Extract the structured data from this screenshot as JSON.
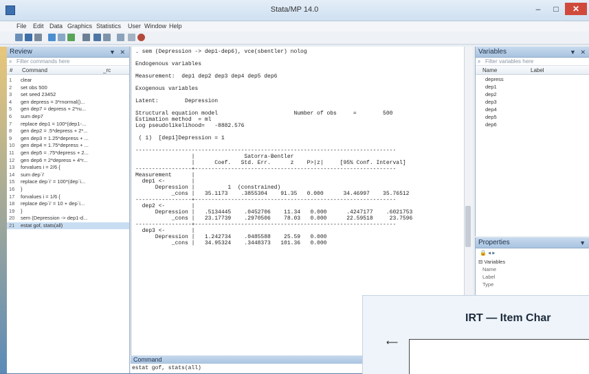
{
  "window": {
    "title": "Stata/MP 14.0",
    "min": "–",
    "max": "□",
    "close": "✕"
  },
  "menu": [
    "File",
    "Edit",
    "Data",
    "Graphics",
    "Statistics",
    "User",
    "Window",
    "Help"
  ],
  "review": {
    "title": "Review",
    "filter_placeholder": "Filter commands here",
    "col_num": "#",
    "col_cmd": "Command",
    "col_rc": "_rc",
    "items": [
      {
        "n": "1",
        "c": "clear"
      },
      {
        "n": "2",
        "c": "set obs 500"
      },
      {
        "n": "3",
        "c": "set seed 23452"
      },
      {
        "n": "4",
        "c": "gen depress = 3*rnormal()..."
      },
      {
        "n": "5",
        "c": "gen dep7 = depress + 2*ru..."
      },
      {
        "n": "6",
        "c": "sum dep7"
      },
      {
        "n": "7",
        "c": "replace dep1 = 100*(dep1-..."
      },
      {
        "n": "8",
        "c": "gen dep2 = .5*depress + 2*..."
      },
      {
        "n": "9",
        "c": "gen dep3 = 1.25*depress + ..."
      },
      {
        "n": "10",
        "c": "gen dep4 = 1.75*depress + ..."
      },
      {
        "n": "11",
        "c": "gen dep5 = .75*depress + 2..."
      },
      {
        "n": "12",
        "c": "gen dep6 = 2*depress + 4*r..."
      },
      {
        "n": "13",
        "c": "forvalues i = 2/6 {"
      },
      {
        "n": "14",
        "c": "  sum dep`i'"
      },
      {
        "n": "15",
        "c": "  replace dep`i' = 100*(dep`i..."
      },
      {
        "n": "16",
        "c": "}"
      },
      {
        "n": "17",
        "c": "forvalues i = 1/6 {"
      },
      {
        "n": "18",
        "c": "  replace dep`i' = 10 + dep`i..."
      },
      {
        "n": "19",
        "c": "}"
      },
      {
        "n": "20",
        "c": "sem (Depression -> dep1-d..."
      },
      {
        "n": "21",
        "c": "estat gof, stats(all)"
      }
    ]
  },
  "results": {
    "text": ". sem (Depression -> dep1-dep6), vce(sbentler) nolog\n\nEndogenous variables\n\nMeasurement:  dep1 dep2 dep3 dep4 dep5 dep6\n\nExogenous variables\n\nLatent:        Depression\n\nStructural equation model                       Number of obs     =        500\nEstimation method  = ml\nLog pseudolikelihood=   -8882.576\n\n ( 1)  [dep1]Depression = 1\n\n-------------------------------------------------------------------------------\n                 |               Satorra-Bentler\n                 |      Coef.   Std. Err.      z    P>|z|     [95% Conf. Interval]\n-----------------+-------------------------------------------------------------\nMeasurement      |\n  dep1 <-        |\n      Depression |          1  (constrained)\n           _cons |   35.1173    .3855304    91.35   0.000      34.46997    35.76512\n-----------------+-------------------------------------------------------------\n  dep2 <-        |\n      Depression |   .5134445    .0452706    11.34   0.000      .4247177    .6021753\n           _cons |   23.17739    .2970506    78.03   0.000      22.59518     23.7596\n-----------------+-------------------------------------------------------------\n  dep3 <-        |\n      Depression |   1.242734    .0485588    25.59   0.000\n           _cons |   34.95324    .3448373   101.36   0.000"
  },
  "command": {
    "title": "Command",
    "value": "estat gof, stats(all)"
  },
  "variables": {
    "title": "Variables",
    "filter_placeholder": "Filter variables here",
    "col_name": "Name",
    "col_label": "Label",
    "items": [
      "depress",
      "dep1",
      "dep2",
      "dep3",
      "dep4",
      "dep5",
      "dep6"
    ]
  },
  "properties": {
    "title": "Properties",
    "section": "Variables",
    "rows": [
      "Name",
      "Label",
      "Type"
    ]
  },
  "irt": {
    "title": "IRT — Item Char"
  }
}
